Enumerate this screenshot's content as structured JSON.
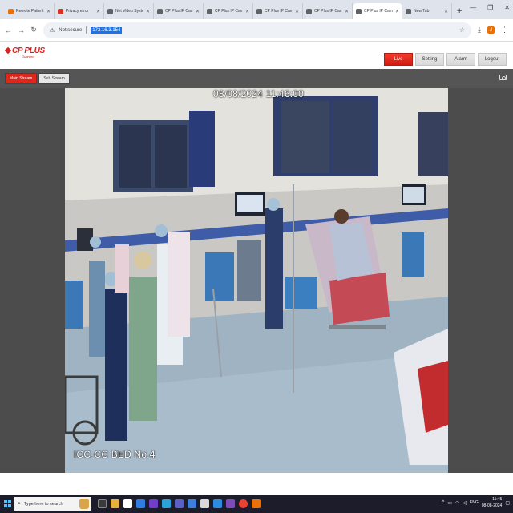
{
  "browser": {
    "tabs": [
      {
        "title": "Remote Patient Moni",
        "favicon_color": "#e8710a"
      },
      {
        "title": "Privacy error",
        "favicon_color": "#d93025"
      },
      {
        "title": "Net Video System",
        "favicon_color": "#5f6368"
      },
      {
        "title": "CP Plus IP Cam",
        "favicon_color": "#5f6368"
      },
      {
        "title": "CP Plus IP Cam",
        "favicon_color": "#5f6368"
      },
      {
        "title": "CP Plus IP Cam",
        "favicon_color": "#5f6368"
      },
      {
        "title": "CP Plus IP Cam",
        "favicon_color": "#5f6368"
      },
      {
        "title": "CP Plus IP Cam",
        "favicon_color": "#5f6368",
        "active": true
      },
      {
        "title": "New Tab",
        "favicon_color": "#5f6368"
      }
    ],
    "address_bar": {
      "security_label": "Not secure",
      "url": "172.16.3.154"
    },
    "profile_initial": "J"
  },
  "app": {
    "logo_text": "CP PLUS",
    "logo_tagline": "Guarded",
    "nav": [
      {
        "label": "Live",
        "active": true
      },
      {
        "label": "Setting"
      },
      {
        "label": "Alarm"
      },
      {
        "label": "Logout"
      }
    ],
    "stream_buttons": {
      "main": "Main Stream",
      "sub": "Sub Stream"
    }
  },
  "video": {
    "timestamp": "08/08/2024 11:46:00",
    "camera_label": "ICC-CC BED No.4"
  },
  "taskbar": {
    "search_placeholder": "Type here to search",
    "tray_language": "ENG",
    "time": "11:45",
    "date": "08-08-2024"
  },
  "colors": {
    "brand_red": "#d6231f",
    "active_nav": "#e0261b",
    "stream_bar": "#555555",
    "video_bg": "#4c4c4c"
  }
}
